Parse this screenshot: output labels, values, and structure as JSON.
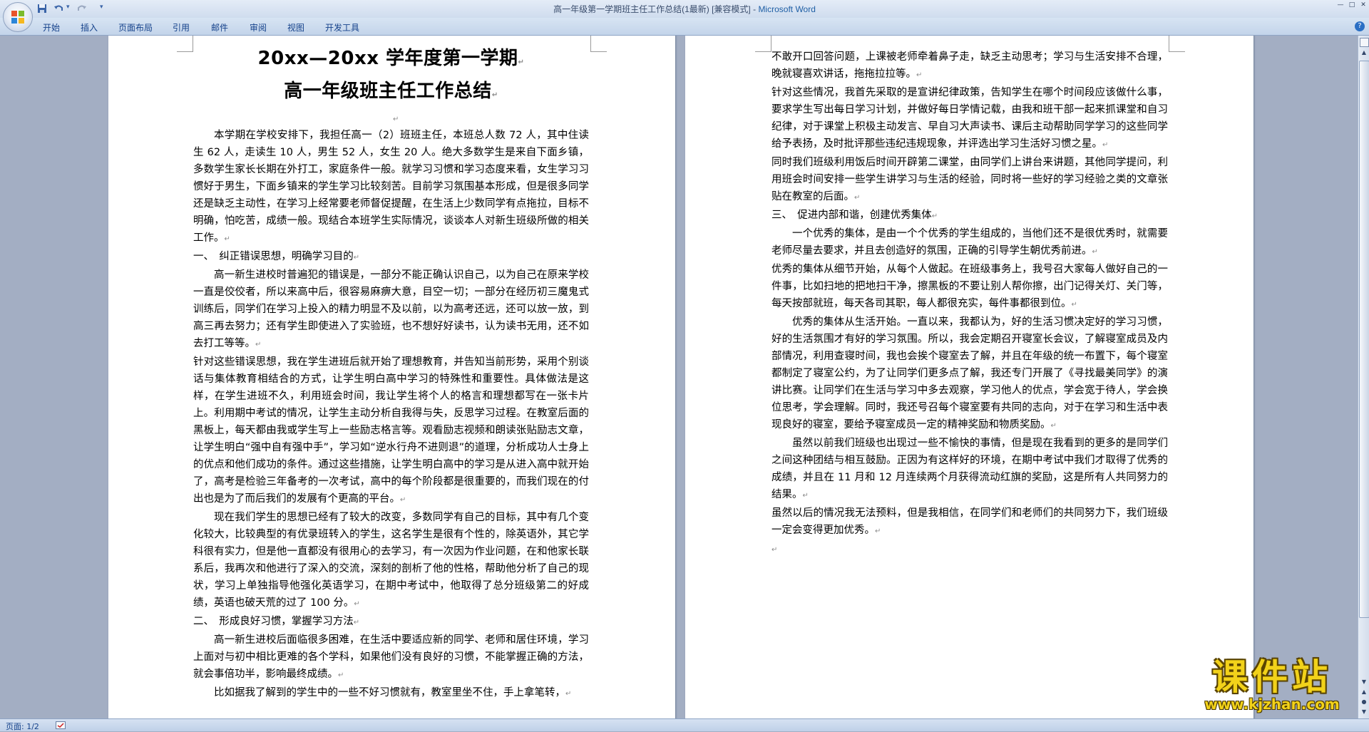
{
  "window": {
    "title": "高一年级第一学期班主任工作总结(1最新) [兼容模式] - ",
    "app_name": "Microsoft Word",
    "controls": [
      "—",
      "□",
      "✕"
    ]
  },
  "ribbon": {
    "tabs": [
      "开始",
      "插入",
      "页面布局",
      "引用",
      "邮件",
      "审阅",
      "视图",
      "开发工具"
    ],
    "help": "?"
  },
  "page1": {
    "title_line1": "20xx—20xx 学年度第一学期",
    "title_line2": "高一年级班主任工作总结",
    "paragraphs": [
      {
        "indent": true,
        "text": "本学期在学校安排下，我担任高一（2）班班主任，本班总人数 72 人，其中住读生 62 人，走读生 10 人，男生 52 人，女生 20 人。绝大多数学生是来自下面乡镇，多数学生家长长期在外打工，家庭条件一般。就学习习惯和学习态度来看，女生学习习惯好于男生，下面乡镇来的学生学习比较刻苦。目前学习氛围基本形成，但是很多同学还是缺乏主动性，在学习上经常要老师督促提醒，在生活上少数同学有点拖拉，目标不明确，怕吃苦，成绩一般。现结合本班学生实际情况，谈谈本人对新生班级所做的相关工作。"
      },
      {
        "indent": false,
        "text": "一、　纠正错误思想，明确学习目的"
      },
      {
        "indent": true,
        "text": "高一新生进校时普遍犯的错误是，一部分不能正确认识自己，以为自己在原来学校一直是佼佼者，所以来高中后，很容易麻痹大意，目空一切；一部分在经历初三魔鬼式训练后，同学们在学习上投入的精力明显不及以前，以为高考还远，还可以放一放，到高三再去努力；还有学生即使进入了实验班，也不想好好读书，认为读书无用，还不如去打工等等。"
      },
      {
        "indent": false,
        "text": "针对这些错误思想，我在学生进班后就开始了理想教育，并告知当前形势，采用个别谈话与集体教育相结合的方式，让学生明白高中学习的特殊性和重要性。具体做法是这样，在学生进班不久，利用班会时间，我让学生将个人的格言和理想都写在一张卡片上。利用期中考试的情况，让学生主动分析自我得与失，反思学习过程。在教室后面的黑板上，每天都由我或学生写上一些励志格言等。观看励志视频和朗读张贴励志文章，让学生明白“强中自有强中手”，学习如“逆水行舟不进则退”的道理，分析成功人士身上的优点和他们成功的条件。通过这些措施，让学生明白高中的学习是从进入高中就开始了，高考是检验三年备考的一次考试，高中的每个阶段都是很重要的，而我们现在的付出也是为了而后我们的发展有个更高的平台。"
      },
      {
        "indent": true,
        "text": "现在我们学生的思想已经有了较大的改变，多数同学有自己的目标，其中有几个变化较大，比较典型的有优录班转入的学生，这名学生是很有个性的，除英语外，其它学科很有实力，但是他一直都没有很用心的去学习，有一次因为作业问题，在和他家长联系后，我再次和他进行了深入的交流，深刻的剖析了他的性格，帮助他分析了自己的现状，学习上单独指导他强化英语学习，在期中考试中，他取得了总分班级第二的好成绩，英语也破天荒的过了 100 分。"
      },
      {
        "indent": false,
        "text": "二、　形成良好习惯，掌握学习方法"
      },
      {
        "indent": true,
        "text": "高一新生进校后面临很多困难，在生活中要适应新的同学、老师和居住环境，学习上面对与初中相比更难的各个学科，如果他们没有良好的习惯，不能掌握正确的方法，就会事倍功半，影响最终成绩。"
      },
      {
        "indent": true,
        "text": "比如据我了解到的学生中的一些不好习惯就有，教室里坐不住，手上拿笔转，"
      }
    ]
  },
  "page2": {
    "paragraphs": [
      {
        "indent": false,
        "text": "不敢开口回答问题，上课被老师牵着鼻子走，缺乏主动思考；学习与生活安排不合理，晚就寝喜欢讲话，拖拖拉拉等。"
      },
      {
        "indent": false,
        "text": "针对这些情况，我首先采取的是宣讲纪律政策，告知学生在哪个时间段应该做什么事，要求学生写出每日学习计划，并做好每日学情记载，由我和班干部一起来抓课堂和自习纪律，对于课堂上积极主动发言、早自习大声读书、课后主动帮助同学学习的这些同学给予表扬，及时批评那些违纪违规现象，并评选出学习生活好习惯之星。"
      },
      {
        "indent": false,
        "text": "同时我们班级利用饭后时间开辟第二课堂，由同学们上讲台来讲题，其他同学提问，利用班会时间安排一些学生讲学习与生活的经验，同时将一些好的学习经验之类的文章张贴在教室的后面。"
      },
      {
        "indent": false,
        "text": "三、　促进内部和谐，创建优秀集体"
      },
      {
        "indent": true,
        "text": "一个优秀的集体，是由一个个优秀的学生组成的，当他们还不是很优秀时，就需要老师尽量去要求，并且去创造好的氛围，正确的引导学生朝优秀前进。"
      },
      {
        "indent": false,
        "text": "优秀的集体从细节开始，从每个人做起。在班级事务上，我号召大家每人做好自己的一件事，比如扫地的把地扫干净，擦黑板的不要让别人帮你擦，出门记得关灯、关门等，每天按部就班，每天各司其职，每人都很充实，每件事都很到位。"
      },
      {
        "indent": true,
        "text": "优秀的集体从生活开始。一直以来，我都认为，好的生活习惯决定好的学习习惯，好的生活氛围才有好的学习氛围。所以，我会定期召开寝室长会议，了解寝室成员及内部情况，利用查寝时间，我也会挨个寝室去了解，并且在年级的统一布置下，每个寝室都制定了寝室公约，为了让同学们更多点了解，我还专门开展了《寻找最美同学》的演讲比赛。让同学们在生活与学习中多去观察，学习他人的优点，学会宽于待人，学会换位思考，学会理解。同时，我还号召每个寝室要有共同的志向，对于在学习和生活中表现良好的寝室，要给予寝室成员一定的精神奖励和物质奖励。"
      },
      {
        "indent": true,
        "text": "虽然以前我们班级也出现过一些不愉快的事情，但是现在我看到的更多的是同学们之间这种团结与相互鼓励。正因为有这样好的环境，在期中考试中我们才取得了优秀的成绩，并且在 11 月和 12 月连续两个月获得流动红旗的奖励，这是所有人共同努力的结果。"
      },
      {
        "indent": false,
        "text": "虽然以后的情况我无法预料，但是我相信，在同学们和老师们的共同努力下，我们班级一定会变得更加优秀。"
      }
    ]
  },
  "status": {
    "page_count": "页面: 1/2"
  },
  "watermark": {
    "main": "课件站",
    "url": "www.kjzhan.com"
  }
}
